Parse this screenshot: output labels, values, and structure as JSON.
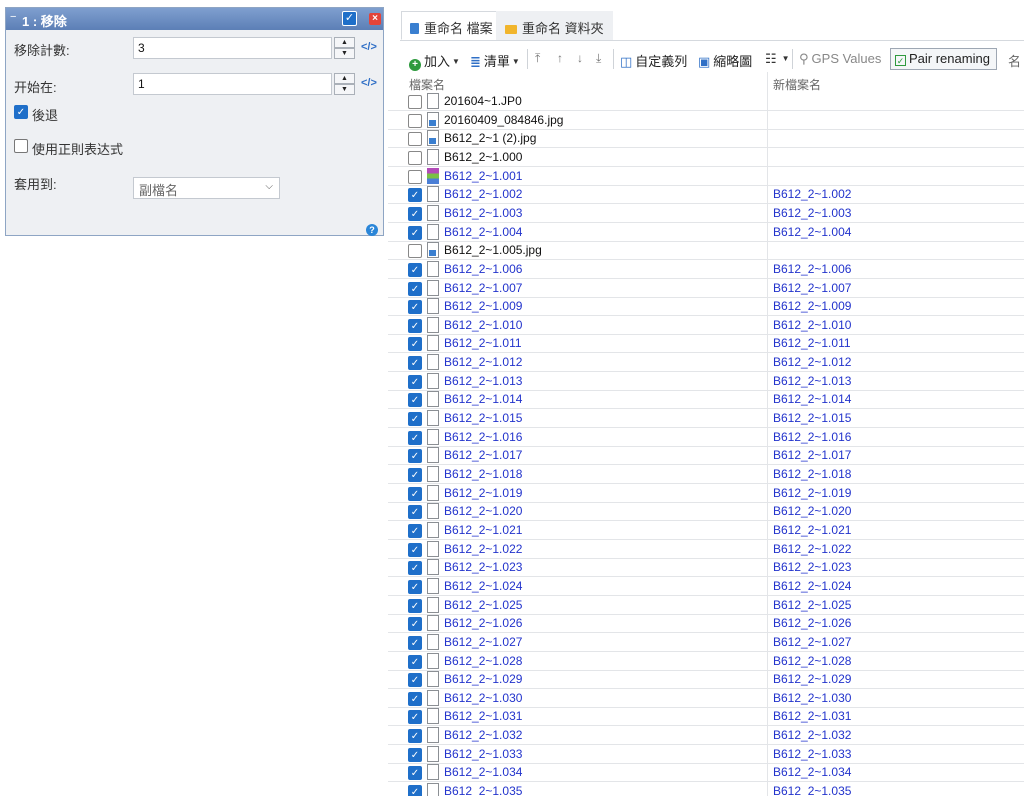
{
  "rule": {
    "collapse": "−",
    "title": "1 : 移除",
    "enabled_check": "✓",
    "close": "×",
    "remove_count_label": "移除計數:",
    "remove_count_value": "3",
    "start_at_label": "开始在:",
    "start_at_value": "1",
    "backward_label": "後退",
    "backward_checked": true,
    "regex_label": "使用正則表达式",
    "regex_checked": false,
    "apply_to_label": "套用到:",
    "apply_to_value": "副檔名",
    "spin_up": "▲",
    "spin_down": "▼",
    "code_icon": "</>",
    "help_icon": "?",
    "dropdown_arrow": "⌵"
  },
  "tabs": [
    {
      "label": "重命名 檔案",
      "active": true
    },
    {
      "label": "重命名 資料夾",
      "active": false
    }
  ],
  "toolbar": {
    "add": "加入",
    "list": "清單",
    "custom_sort": "自定義列",
    "thumbnail": "縮略圖",
    "gps": "GPS Values",
    "pair": "Pair renaming",
    "trailing": "名"
  },
  "grid": {
    "col_name": "檔案名",
    "col_new": "新檔案名",
    "rows": [
      {
        "checked": false,
        "icon": "file",
        "name": "201604~1.JP0",
        "new": "",
        "color": "black"
      },
      {
        "checked": false,
        "icon": "jpg",
        "name": "20160409_084846.jpg",
        "new": "",
        "color": "black"
      },
      {
        "checked": false,
        "icon": "jpg",
        "name": "B612_2~1 (2).jpg",
        "new": "",
        "color": "black"
      },
      {
        "checked": false,
        "icon": "file",
        "name": "B612_2~1.000",
        "new": "",
        "color": "black"
      },
      {
        "checked": false,
        "icon": "rar",
        "name": "B612_2~1.001",
        "new": "",
        "color": "blue"
      },
      {
        "checked": true,
        "icon": "file",
        "name": "B612_2~1.002",
        "new": "B612_2~1.002",
        "color": "blue"
      },
      {
        "checked": true,
        "icon": "file",
        "name": "B612_2~1.003",
        "new": "B612_2~1.003",
        "color": "blue"
      },
      {
        "checked": true,
        "icon": "file",
        "name": "B612_2~1.004",
        "new": "B612_2~1.004",
        "color": "blue"
      },
      {
        "checked": false,
        "icon": "jpg",
        "name": "B612_2~1.005.jpg",
        "new": "",
        "color": "black"
      },
      {
        "checked": true,
        "icon": "file",
        "name": "B612_2~1.006",
        "new": "B612_2~1.006",
        "color": "blue"
      },
      {
        "checked": true,
        "icon": "file",
        "name": "B612_2~1.007",
        "new": "B612_2~1.007",
        "color": "blue"
      },
      {
        "checked": true,
        "icon": "file",
        "name": "B612_2~1.009",
        "new": "B612_2~1.009",
        "color": "blue"
      },
      {
        "checked": true,
        "icon": "file",
        "name": "B612_2~1.010",
        "new": "B612_2~1.010",
        "color": "blue"
      },
      {
        "checked": true,
        "icon": "file",
        "name": "B612_2~1.011",
        "new": "B612_2~1.011",
        "color": "blue"
      },
      {
        "checked": true,
        "icon": "file",
        "name": "B612_2~1.012",
        "new": "B612_2~1.012",
        "color": "blue"
      },
      {
        "checked": true,
        "icon": "file",
        "name": "B612_2~1.013",
        "new": "B612_2~1.013",
        "color": "blue"
      },
      {
        "checked": true,
        "icon": "file",
        "name": "B612_2~1.014",
        "new": "B612_2~1.014",
        "color": "blue"
      },
      {
        "checked": true,
        "icon": "file",
        "name": "B612_2~1.015",
        "new": "B612_2~1.015",
        "color": "blue"
      },
      {
        "checked": true,
        "icon": "file",
        "name": "B612_2~1.016",
        "new": "B612_2~1.016",
        "color": "blue"
      },
      {
        "checked": true,
        "icon": "file",
        "name": "B612_2~1.017",
        "new": "B612_2~1.017",
        "color": "blue"
      },
      {
        "checked": true,
        "icon": "file",
        "name": "B612_2~1.018",
        "new": "B612_2~1.018",
        "color": "blue"
      },
      {
        "checked": true,
        "icon": "file",
        "name": "B612_2~1.019",
        "new": "B612_2~1.019",
        "color": "blue"
      },
      {
        "checked": true,
        "icon": "file",
        "name": "B612_2~1.020",
        "new": "B612_2~1.020",
        "color": "blue"
      },
      {
        "checked": true,
        "icon": "file",
        "name": "B612_2~1.021",
        "new": "B612_2~1.021",
        "color": "blue"
      },
      {
        "checked": true,
        "icon": "file",
        "name": "B612_2~1.022",
        "new": "B612_2~1.022",
        "color": "blue"
      },
      {
        "checked": true,
        "icon": "file",
        "name": "B612_2~1.023",
        "new": "B612_2~1.023",
        "color": "blue"
      },
      {
        "checked": true,
        "icon": "file",
        "name": "B612_2~1.024",
        "new": "B612_2~1.024",
        "color": "blue"
      },
      {
        "checked": true,
        "icon": "file",
        "name": "B612_2~1.025",
        "new": "B612_2~1.025",
        "color": "blue"
      },
      {
        "checked": true,
        "icon": "file",
        "name": "B612_2~1.026",
        "new": "B612_2~1.026",
        "color": "blue"
      },
      {
        "checked": true,
        "icon": "file",
        "name": "B612_2~1.027",
        "new": "B612_2~1.027",
        "color": "blue"
      },
      {
        "checked": true,
        "icon": "file",
        "name": "B612_2~1.028",
        "new": "B612_2~1.028",
        "color": "blue"
      },
      {
        "checked": true,
        "icon": "file",
        "name": "B612_2~1.029",
        "new": "B612_2~1.029",
        "color": "blue"
      },
      {
        "checked": true,
        "icon": "file",
        "name": "B612_2~1.030",
        "new": "B612_2~1.030",
        "color": "blue"
      },
      {
        "checked": true,
        "icon": "file",
        "name": "B612_2~1.031",
        "new": "B612_2~1.031",
        "color": "blue"
      },
      {
        "checked": true,
        "icon": "file",
        "name": "B612_2~1.032",
        "new": "B612_2~1.032",
        "color": "blue"
      },
      {
        "checked": true,
        "icon": "file",
        "name": "B612_2~1.033",
        "new": "B612_2~1.033",
        "color": "blue"
      },
      {
        "checked": true,
        "icon": "file",
        "name": "B612_2~1.034",
        "new": "B612_2~1.034",
        "color": "blue"
      },
      {
        "checked": true,
        "icon": "file",
        "name": "B612_2~1.035",
        "new": "B612_2~1.035",
        "color": "blue"
      }
    ]
  },
  "colors": {
    "accent": "#1f6fc9",
    "link_blue": "#2233cc",
    "header_blue": "#5c7fb6"
  }
}
